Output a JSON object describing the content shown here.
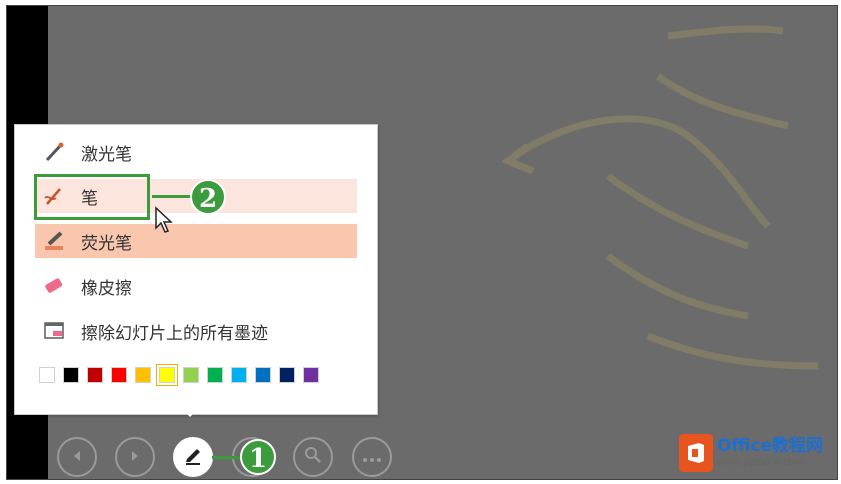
{
  "menu": {
    "items": [
      {
        "label": "激光笔",
        "icon": "laser-pointer-icon"
      },
      {
        "label": "笔",
        "icon": "pen-icon"
      },
      {
        "label": "荧光笔",
        "icon": "highlighter-icon"
      },
      {
        "label": "橡皮擦",
        "icon": "eraser-icon"
      },
      {
        "label": "擦除幻灯片上的所有墨迹",
        "icon": "erase-all-ink-icon"
      }
    ],
    "colors": [
      "#ffffff",
      "#000000",
      "#c00000",
      "#ff0000",
      "#ffc000",
      "#ffff00",
      "#92d050",
      "#00b050",
      "#00b0f0",
      "#0070c0",
      "#002060",
      "#7030a0"
    ],
    "selected_color": "#ffff00"
  },
  "callouts": {
    "menu_step": "2",
    "toolbar_step": "1"
  },
  "toolbar": {
    "buttons": [
      "previous-icon",
      "next-icon",
      "pen-icon",
      "pen-options-icon",
      "zoom-icon",
      "more-icon"
    ]
  },
  "watermark": {
    "name": "Office教程网",
    "url": "www.pptxxw.com"
  }
}
